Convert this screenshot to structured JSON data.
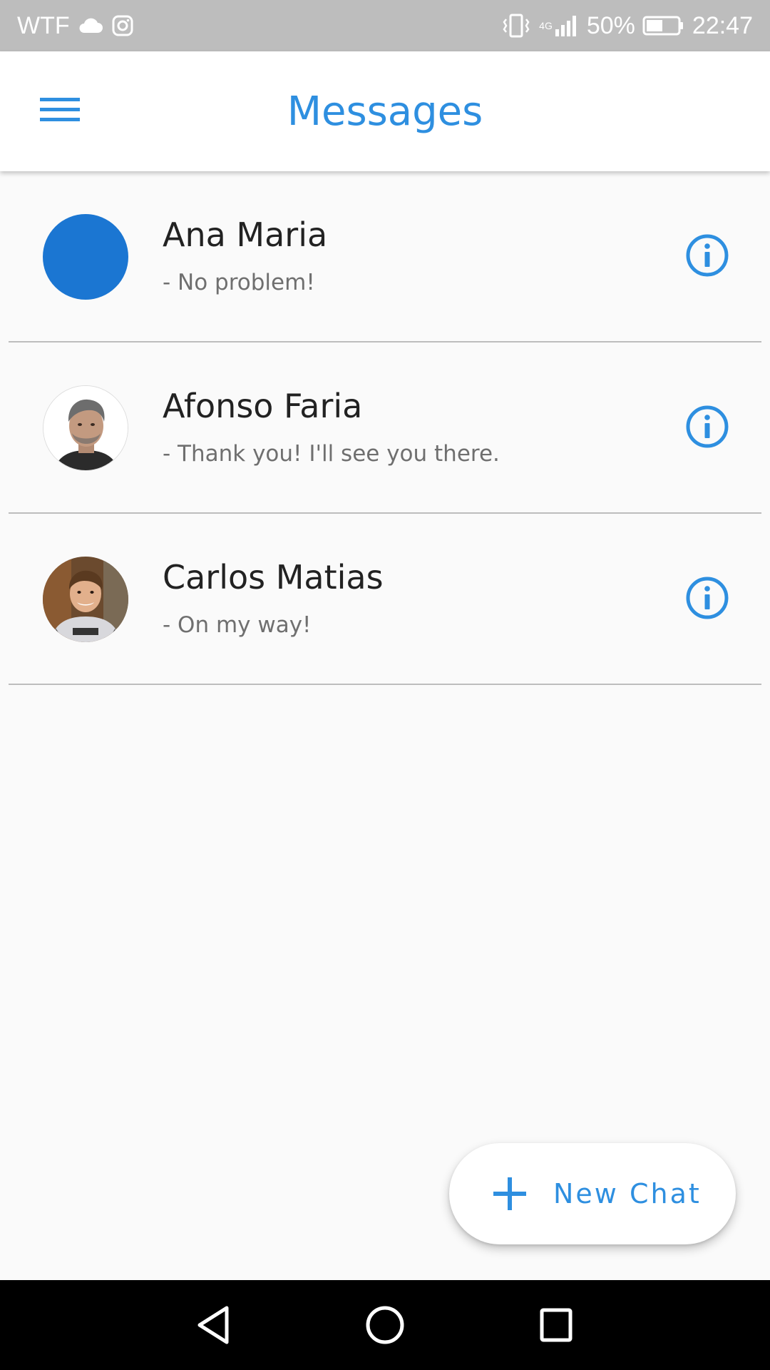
{
  "status_bar": {
    "left_text": "WTF",
    "network_label": "4G",
    "battery_percent": "50%",
    "time": "22:47",
    "icons": [
      "cloud-icon",
      "instagram-icon",
      "vibrate-icon",
      "signal-icon",
      "battery-icon"
    ]
  },
  "app_bar": {
    "title": "Messages",
    "menu_icon": "hamburger-menu-icon"
  },
  "conversations": [
    {
      "name": "Ana Maria",
      "preview": "- No problem!",
      "avatar": "solid-blue-circle",
      "info_icon": "info-icon"
    },
    {
      "name": "Afonso Faria",
      "preview": "- Thank you! I'll see you there.",
      "avatar": "photo-man-grey-hair",
      "info_icon": "info-icon"
    },
    {
      "name": "Carlos Matias",
      "preview": "- On my way!",
      "avatar": "photo-young-man-hoodie",
      "info_icon": "info-icon"
    }
  ],
  "fab": {
    "label": "New Chat",
    "icon": "plus-icon"
  },
  "nav_bar": {
    "icons": [
      "back-triangle-icon",
      "home-circle-icon",
      "recents-square-icon"
    ]
  },
  "colors": {
    "accent": "#2e8fe0",
    "avatar_blue": "#1b76d2",
    "status_bar": "#bdbdbd",
    "background": "#fafafa",
    "divider": "#bdbdbd",
    "nav_bar": "#000000"
  }
}
